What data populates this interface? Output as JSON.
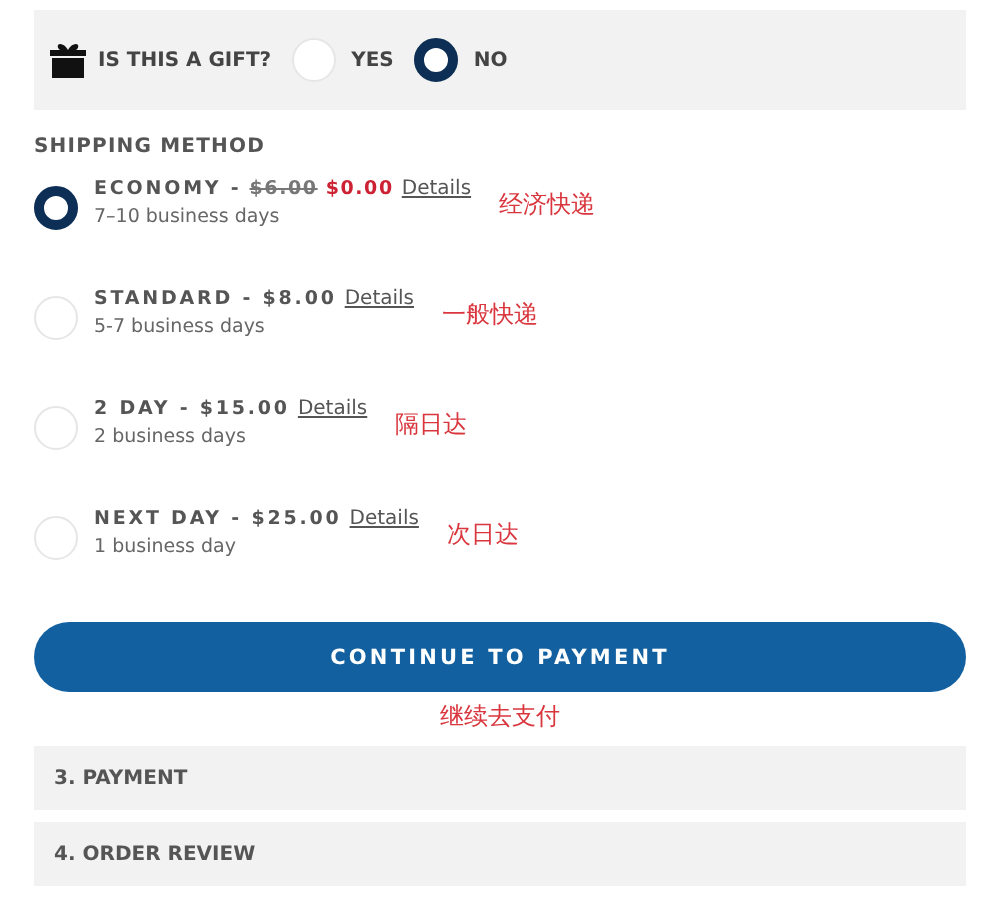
{
  "gift": {
    "label": "IS THIS A GIFT?",
    "options": [
      {
        "label": "YES",
        "selected": false
      },
      {
        "label": "NO",
        "selected": true
      }
    ]
  },
  "shipping": {
    "heading": "SHIPPING METHOD",
    "options": [
      {
        "label": "ECONOMY -",
        "old_price": "$6.00",
        "price": "$0.00",
        "link": "Details",
        "days": "7–10 business days",
        "annotation": "经济快递",
        "selected": true
      },
      {
        "label": "STANDARD - $8.00",
        "link": "Details",
        "days": "5-7 business days",
        "annotation": "一般快递",
        "selected": false
      },
      {
        "label": "2 DAY - $15.00",
        "link": "Details",
        "days": "2 business days",
        "annotation": "隔日达",
        "selected": false
      },
      {
        "label": "NEXT DAY - $25.00",
        "link": "Details",
        "days": "1 business day",
        "annotation": "次日达",
        "selected": false
      }
    ]
  },
  "continue_button": {
    "label": "CONTINUE TO PAYMENT",
    "annotation": "继续去支付"
  },
  "sections": [
    "3. PAYMENT",
    "4. ORDER REVIEW"
  ]
}
